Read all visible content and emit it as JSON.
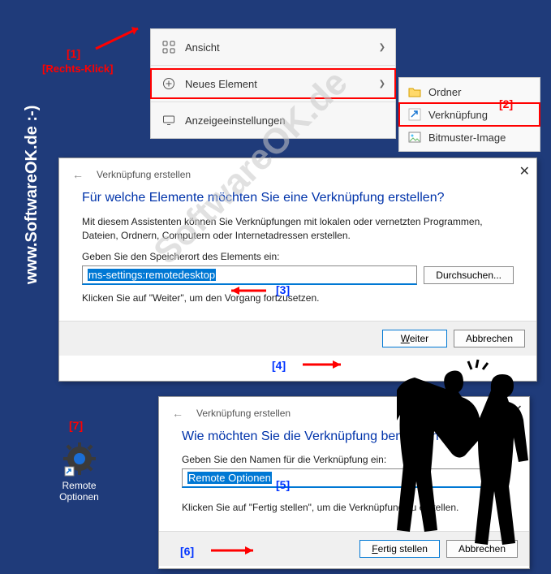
{
  "watermark_side": "www.SoftwareOK.de :-)",
  "watermark_diag": "SoftwareOK.de",
  "annotations": {
    "a1": "[1]",
    "a1_sub": "[Rechts-Klick]",
    "a2": "[2]",
    "a3": "[3]",
    "a4": "[4]",
    "a5": "[5]",
    "a6": "[6]",
    "a7": "[7]"
  },
  "context_menu": {
    "ansicht": "Ansicht",
    "neues_element": "Neues Element",
    "anzeigeeinstellungen": "Anzeigeeinstellungen"
  },
  "submenu": {
    "ordner": "Ordner",
    "verknuepfung": "Verknüpfung",
    "bitmuster": "Bitmuster-Image"
  },
  "dialog1": {
    "breadcrumb": "Verknüpfung erstellen",
    "title": "Für welche Elemente möchten Sie eine Verknüpfung erstellen?",
    "desc": "Mit diesem Assistenten können Sie Verknüpfungen mit lokalen oder vernetzten Programmen, Dateien, Ordnern, Computern oder Internetadressen erstellen.",
    "label": "Geben Sie den Speicherort des Elements ein:",
    "input": "ms-settings:remotedesktop",
    "browse": "Durchsuchen...",
    "hint": "Klicken Sie auf \"Weiter\", um den Vorgang fortzusetzen.",
    "next": "Weiter",
    "cancel": "Abbrechen"
  },
  "dialog2": {
    "breadcrumb": "Verknüpfung erstellen",
    "title": "Wie möchten Sie die Verknüpfung benennen?",
    "label": "Geben Sie den Namen für die Verknüpfung ein:",
    "input": "Remote Optionen",
    "hint": "Klicken Sie auf \"Fertig stellen\", um die Verknüpfung zu erstellen.",
    "finish": "Fertig stellen",
    "cancel": "Abbrechen"
  },
  "desktop_icon": {
    "label": "Remote Optionen"
  }
}
